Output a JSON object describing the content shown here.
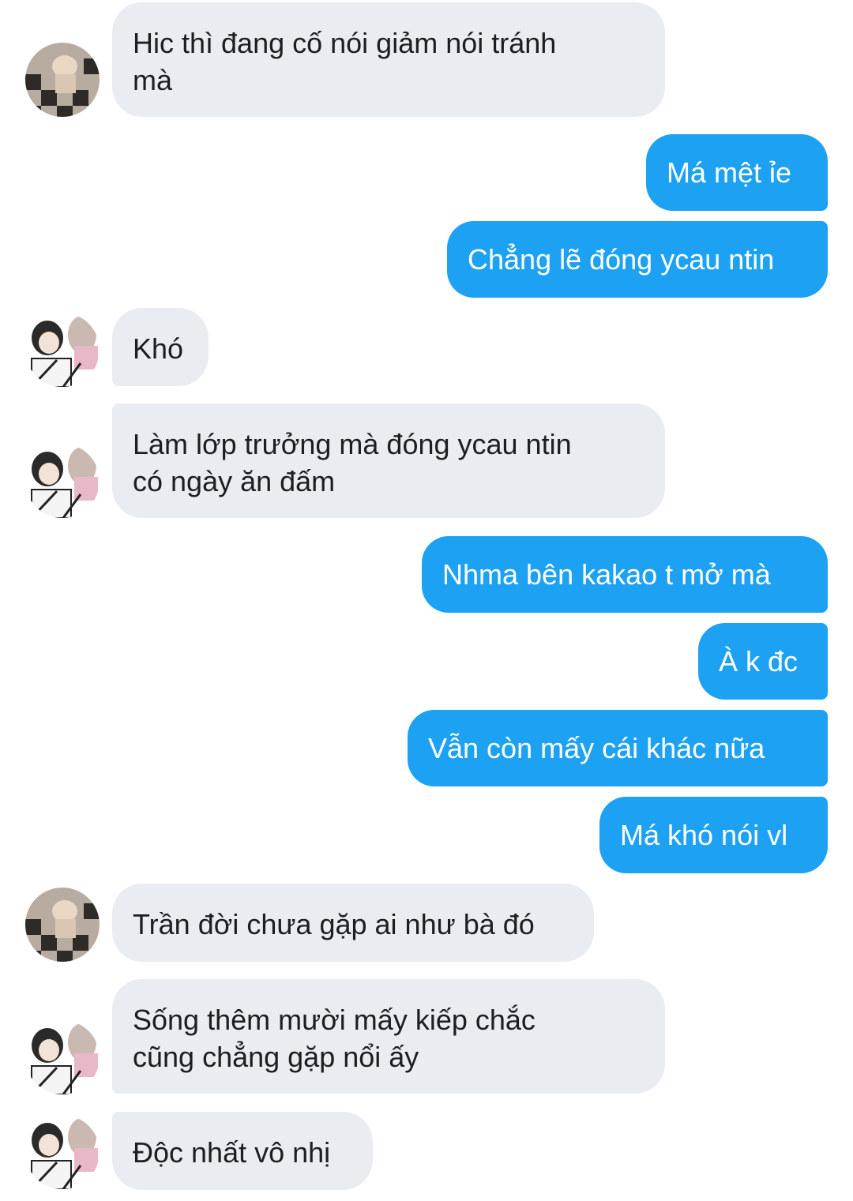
{
  "messages": [
    {
      "sender": "them",
      "avatar": "avatar-checkerboard",
      "lines": [
        "Hic thì đang cố nói giảm nói tránh",
        "mà"
      ]
    },
    {
      "sender": "me",
      "lines": [
        "Má mệt ỉe"
      ]
    },
    {
      "sender": "me",
      "lines": [
        "Chẳng lẽ đóng ycau ntin"
      ]
    },
    {
      "sender": "them",
      "avatar": "avatar-selfie",
      "lines": [
        "Khó"
      ]
    },
    {
      "sender": "them",
      "avatar": "avatar-selfie",
      "lines": [
        "Làm lớp trưởng mà đóng ycau ntin",
        "có ngày ăn đấm"
      ]
    },
    {
      "sender": "me",
      "lines": [
        "Nhma bên kakao t mở mà"
      ]
    },
    {
      "sender": "me",
      "lines": [
        "À k đc"
      ]
    },
    {
      "sender": "me",
      "lines": [
        "Vẫn còn mấy cái khác nữa"
      ]
    },
    {
      "sender": "me",
      "lines": [
        "Má khó nói vl"
      ]
    },
    {
      "sender": "them",
      "avatar": "avatar-checkerboard",
      "lines": [
        "Trần đời chưa gặp ai như bà đó"
      ]
    },
    {
      "sender": "them",
      "avatar": "avatar-selfie",
      "lines": [
        "Sống thêm mười mấy kiếp chắc",
        "cũng chẳng gặp nổi ấy"
      ]
    },
    {
      "sender": "them",
      "avatar": "avatar-selfie",
      "lines": [
        "Độc nhất vô nhị"
      ]
    }
  ],
  "colors": {
    "incoming_bubble": "#e9ecf0",
    "incoming_text": "#1c1e21",
    "outgoing_bubble": "#1da1f2",
    "outgoing_text": "#ffffff"
  }
}
